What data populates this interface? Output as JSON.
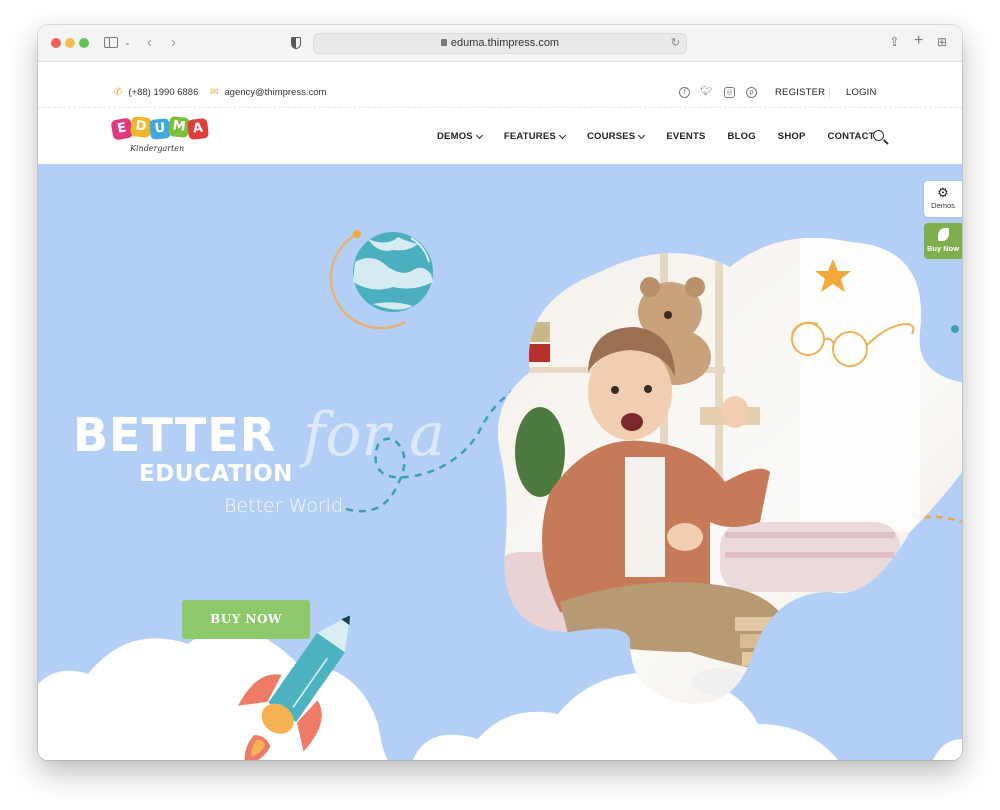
{
  "browser": {
    "url": "eduma.thimpress.com",
    "icons": [
      "sidebar-icon",
      "back-icon",
      "forward-icon",
      "privacy-shield-icon",
      "reload-icon",
      "share-icon",
      "new-tab-icon",
      "tab-overview-icon"
    ]
  },
  "topbar": {
    "phone": "(+88) 1990 6886",
    "email": "agency@thimpress.com",
    "social_icons": [
      "facebook-icon",
      "twitter-icon",
      "instagram-icon",
      "pinterest-icon"
    ],
    "register": "REGISTER",
    "login": "LOGIN"
  },
  "logo": {
    "letters": [
      "E",
      "D",
      "U",
      "M",
      "A"
    ],
    "subtitle": "Kindergarten",
    "colors": [
      "#e2377f",
      "#f0b72e",
      "#3fa8de",
      "#7cbf3b",
      "#e03c3c"
    ]
  },
  "nav": {
    "items": [
      {
        "label": "DEMOS",
        "dropdown": true
      },
      {
        "label": "FEATURES",
        "dropdown": true
      },
      {
        "label": "COURSES",
        "dropdown": true
      },
      {
        "label": "EVENTS",
        "dropdown": false
      },
      {
        "label": "BLOG",
        "dropdown": false
      },
      {
        "label": "SHOP",
        "dropdown": false
      },
      {
        "label": "CONTACT",
        "dropdown": false
      }
    ]
  },
  "hero": {
    "title": "BETTER",
    "subtitle": "EDUCATION",
    "script": "for a",
    "tagline": "Better World",
    "cta": "BUY NOW",
    "background": "#b3cff6",
    "cta_color": "#8dc86b"
  },
  "side_panel": {
    "demos": "Demos",
    "buy_now": "Buy Now"
  }
}
